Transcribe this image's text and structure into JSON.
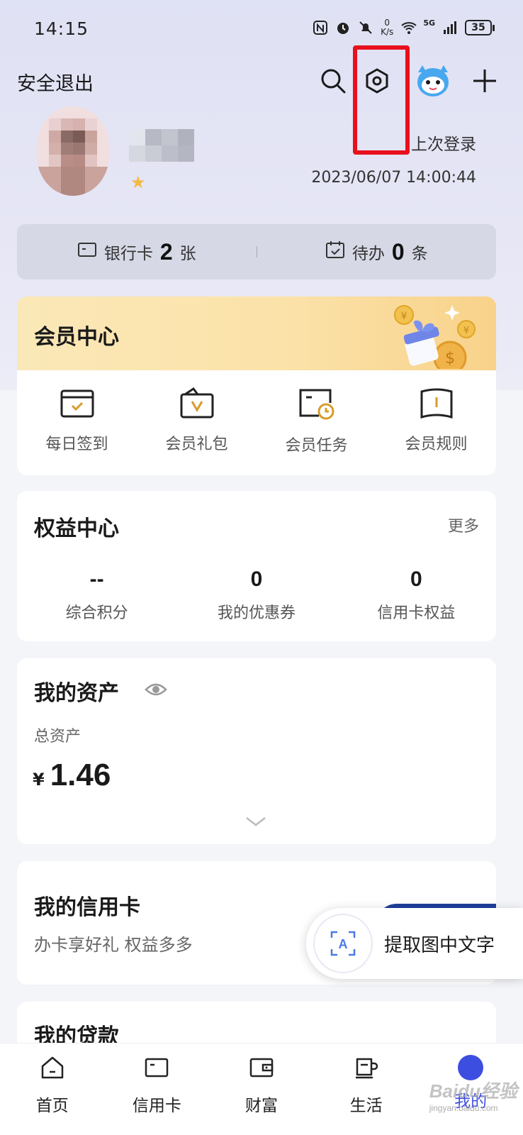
{
  "status_bar": {
    "time": "14:15",
    "speed_value": "0",
    "speed_unit": "K/s",
    "network": "5G",
    "battery": "35",
    "icons": [
      "nfc-icon",
      "alarm-icon",
      "mute-icon",
      "wifi-icon",
      "signal-icon",
      "battery-icon"
    ]
  },
  "header": {
    "logout_label": "安全退出",
    "icons": [
      "search-icon",
      "settings-icon",
      "mascot-icon",
      "plus-icon"
    ],
    "highlight_color": "#e8101c"
  },
  "profile": {
    "last_login_label": "上次登录",
    "last_login_time": "2023/06/07 14:00:44"
  },
  "stats": {
    "bank_card_label": "银行卡",
    "bank_card_count": "2",
    "bank_card_unit": "张",
    "todo_label": "待办",
    "todo_count": "0",
    "todo_unit": "条"
  },
  "member_center": {
    "title": "会员中心",
    "items": [
      {
        "label": "每日签到",
        "icon": "calendar-check-icon"
      },
      {
        "label": "会员礼包",
        "icon": "gift-pack-icon"
      },
      {
        "label": "会员任务",
        "icon": "task-icon"
      },
      {
        "label": "会员规则",
        "icon": "rules-book-icon"
      }
    ]
  },
  "rights_center": {
    "title": "权益中心",
    "more_label": "更多",
    "items": [
      {
        "value": "--",
        "label": "综合积分"
      },
      {
        "value": "0",
        "label": "我的优惠券"
      },
      {
        "value": "0",
        "label": "信用卡权益"
      }
    ]
  },
  "assets": {
    "title": "我的资产",
    "total_label": "总资产",
    "currency": "¥",
    "amount": "1.46"
  },
  "credit_card": {
    "title": "我的信用卡",
    "subtitle": "办卡享好礼 权益多多"
  },
  "ocr": {
    "label": "提取图中文字"
  },
  "loan": {
    "title": "我的贷款"
  },
  "bottom_nav": {
    "items": [
      {
        "label": "首页",
        "icon": "home-icon"
      },
      {
        "label": "信用卡",
        "icon": "card-icon"
      },
      {
        "label": "财富",
        "icon": "wallet-icon"
      },
      {
        "label": "生活",
        "icon": "cup-icon"
      },
      {
        "label": "我的",
        "icon": "profile-icon"
      }
    ],
    "active_color": "#3c4ee0"
  },
  "watermark": {
    "brand": "Baidu经验",
    "url": "jingyan.baidu.com"
  }
}
